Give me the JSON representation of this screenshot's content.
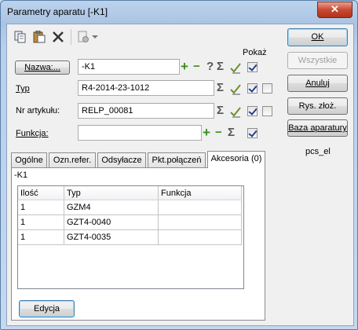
{
  "window": {
    "title": "Parametry aparatu [-K1]",
    "close_glyph": "✕"
  },
  "form": {
    "show_label": "Pokaż",
    "name": {
      "label": "Nazwa:...",
      "value": "-K1"
    },
    "type": {
      "label": "Typ",
      "value": "R4-2014-23-1012"
    },
    "article": {
      "label": "Nr artykułu:",
      "value": "RELP_00081"
    },
    "function": {
      "label": "Funkcja:",
      "value": ""
    }
  },
  "symbols": {
    "plus": "+",
    "minus": "−",
    "question": "?",
    "sigma": "Σ"
  },
  "right_buttons": {
    "ok": "OK",
    "all": "Wszystkie",
    "cancel": "Anuluj",
    "draw": "Rys. złoż.",
    "base": "Baza aparatury",
    "pcs": "pcs_el"
  },
  "tabs": [
    "Ogólne",
    "Ozn.refer.",
    "Odsyłacze",
    "Pkt.połączeń",
    "Akcesoria (0)"
  ],
  "panel": {
    "ref_label": "-K1",
    "columns": [
      "Ilość",
      "Typ",
      "Funkcja"
    ],
    "rows": [
      {
        "qty": "1",
        "type": "GZM4",
        "function": ""
      },
      {
        "qty": "1",
        "type": "GZT4-0040",
        "function": ""
      },
      {
        "qty": "1",
        "type": "GZT4-0035",
        "function": ""
      }
    ],
    "edit_button": "Edycja"
  },
  "checkboxes": {
    "name_show": true,
    "type_show": true,
    "type_extra": false,
    "article_show": true,
    "article_extra": false,
    "function_show": true
  },
  "icons": [
    "copy-icon",
    "paste-icon",
    "delete-icon",
    "page-settings-icon",
    "chevron-down-icon"
  ]
}
